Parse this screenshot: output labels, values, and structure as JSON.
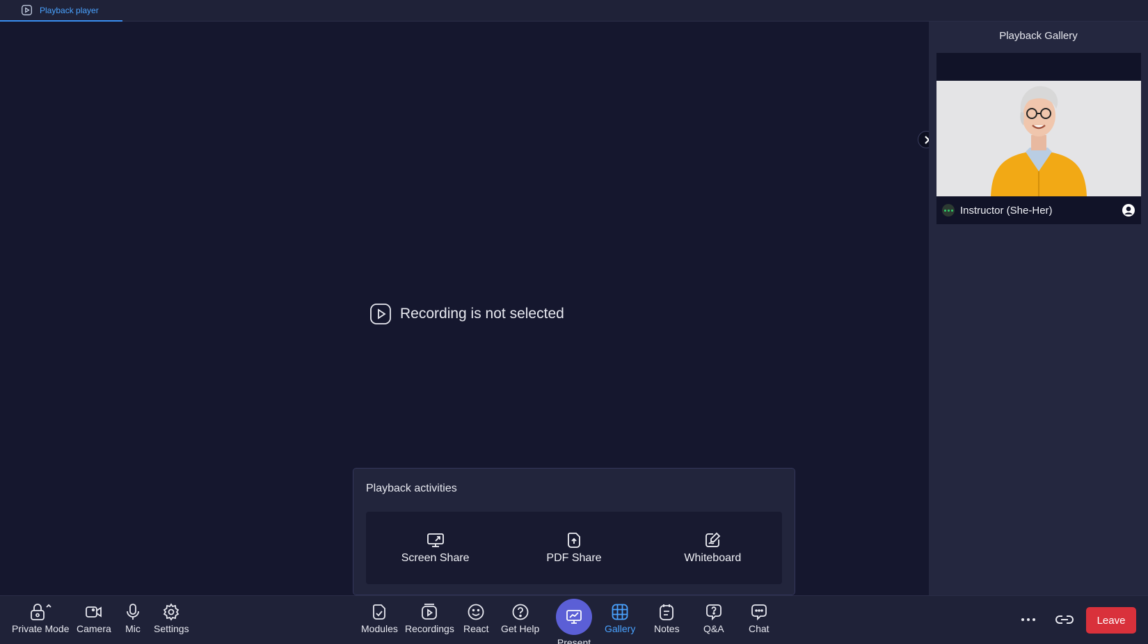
{
  "tabs": [
    {
      "label": "Playback player",
      "icon": "play-square-icon",
      "active": true
    }
  ],
  "stage": {
    "empty_message": "Recording is not selected"
  },
  "activities": {
    "title": "Playback activities",
    "items": [
      {
        "label": "Screen Share",
        "icon": "screen-share-icon"
      },
      {
        "label": "PDF Share",
        "icon": "pdf-share-icon"
      },
      {
        "label": "Whiteboard",
        "icon": "whiteboard-icon"
      }
    ]
  },
  "gallery": {
    "title": "Playback Gallery",
    "participants": [
      {
        "name": "Instructor (She-Her)"
      }
    ]
  },
  "toolbar": {
    "left": [
      {
        "label": "Private Mode",
        "icon": "lock-icon"
      },
      {
        "label": "Camera",
        "icon": "camera-icon"
      },
      {
        "label": "Mic",
        "icon": "mic-icon"
      },
      {
        "label": "Settings",
        "icon": "gear-icon"
      }
    ],
    "center": [
      {
        "label": "Modules",
        "icon": "modules-icon"
      },
      {
        "label": "Recordings",
        "icon": "recordings-icon"
      },
      {
        "label": "React",
        "icon": "smiley-icon"
      },
      {
        "label": "Get Help",
        "icon": "help-icon"
      },
      {
        "label": "Present",
        "icon": "present-icon"
      },
      {
        "label": "Gallery",
        "icon": "grid-icon",
        "active": true
      },
      {
        "label": "Notes",
        "icon": "notes-icon"
      },
      {
        "label": "Q&A",
        "icon": "qa-icon"
      },
      {
        "label": "Chat",
        "icon": "chat-icon"
      }
    ],
    "leave_label": "Leave"
  },
  "colors": {
    "accent": "#4aa3ff",
    "present": "#5b5fd6",
    "leave": "#d9313b",
    "background": "#15172e"
  }
}
